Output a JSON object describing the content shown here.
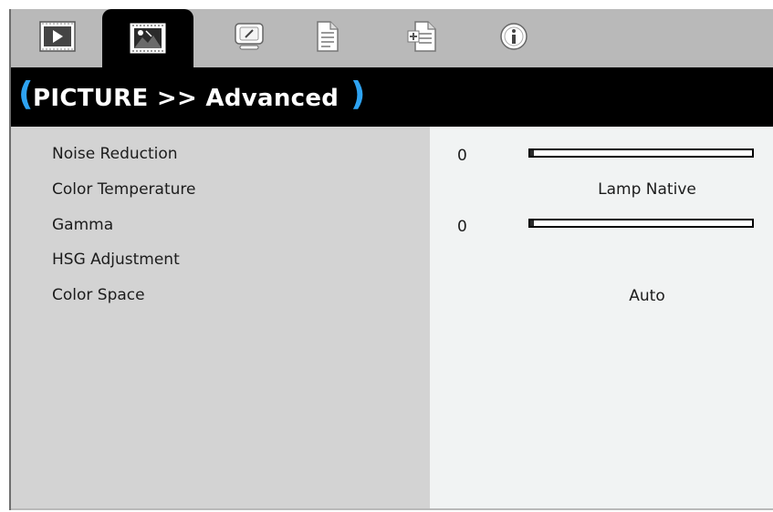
{
  "tabs": [
    {
      "name": "tab-image",
      "icon": "play-screen-icon",
      "active": false
    },
    {
      "name": "tab-picture",
      "icon": "picture-icon",
      "active": true
    },
    {
      "name": "tab-display",
      "icon": "display-icon",
      "active": false
    },
    {
      "name": "tab-setup",
      "icon": "document-icon",
      "active": false
    },
    {
      "name": "tab-options",
      "icon": "document-plus-icon",
      "active": false
    },
    {
      "name": "tab-info",
      "icon": "info-icon",
      "active": false
    }
  ],
  "header": {
    "title": "PICTURE >> Advanced",
    "paren_open": "(",
    "paren_close": ")",
    "accent": "#2ea3f2"
  },
  "menu": {
    "items": [
      {
        "label": "Noise Reduction"
      },
      {
        "label": "Color Temperature"
      },
      {
        "label": "Gamma"
      },
      {
        "label": "HSG Adjustment"
      },
      {
        "label": "Color Space"
      }
    ]
  },
  "values": {
    "noise_reduction": {
      "number": "0",
      "level": 0
    },
    "color_temperature": "Lamp Native",
    "gamma": {
      "number": "0",
      "level": 0
    },
    "color_space": "Auto"
  }
}
